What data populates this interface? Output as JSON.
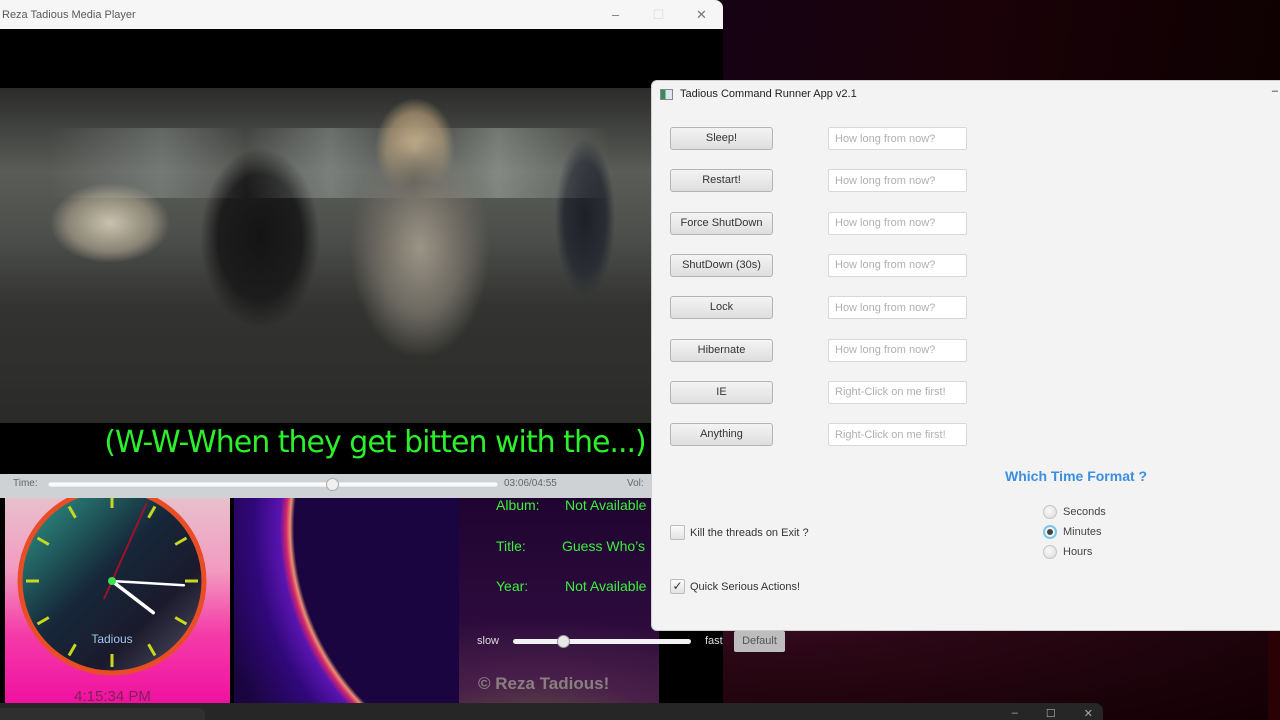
{
  "media_player": {
    "title": "Reza Tadious Media Player",
    "controls": {
      "minimize": "–",
      "maximize": "☐",
      "close": "✕"
    },
    "subtitle": "(W-W-When they get bitten with the...)",
    "seek": {
      "time_label": "Time:",
      "position_text": "03:06/04:55",
      "progress_fraction": 0.63,
      "vol_label": "Vol:"
    },
    "clock": {
      "brand": "Tadious",
      "time": "4:15:34 PM",
      "hours": 4,
      "minutes": 15,
      "seconds": 34
    },
    "info": {
      "album_label": "Album:",
      "album_value": "Not Available",
      "title_label": "Title:",
      "title_value": "Guess Who’s",
      "year_label": "Year:",
      "year_value": "Not Available"
    },
    "speed": {
      "slow_label": "slow",
      "fast_label": "fast",
      "value_fraction": 0.28,
      "default_label": "Default"
    },
    "copyright": "© Reza Tadious!"
  },
  "command_runner": {
    "title": "Tadious Command Runner App v2.1",
    "minimize": "–",
    "commands": [
      {
        "label": "Sleep!",
        "placeholder": "How long from now?"
      },
      {
        "label": "Restart!",
        "placeholder": "How long from now?"
      },
      {
        "label": "Force ShutDown",
        "placeholder": "How long from now?"
      },
      {
        "label": "ShutDown (30s)",
        "placeholder": "How long from now?"
      },
      {
        "label": "Lock",
        "placeholder": "How long from now?"
      },
      {
        "label": "Hibernate",
        "placeholder": "How long from now?"
      },
      {
        "label": "IE",
        "placeholder": "Right-Click on me first!"
      },
      {
        "label": "Anything",
        "placeholder": "Right-Click on me first!"
      }
    ],
    "time_format": {
      "heading": "Which Time Format ?",
      "options": [
        "Seconds",
        "Minutes",
        "Hours"
      ],
      "selected": "Minutes"
    },
    "checkboxes": [
      {
        "label": "Kill the threads on Exit ?",
        "checked": false
      },
      {
        "label": "Quick Serious Actions!",
        "checked": true
      }
    ],
    "colors": {
      "heading": "#3a8fe0",
      "radio_focus": "#79c6e8"
    }
  },
  "bottom_window": {
    "controls": {
      "minimize": "–",
      "maximize": "☐",
      "close": "✕"
    }
  }
}
